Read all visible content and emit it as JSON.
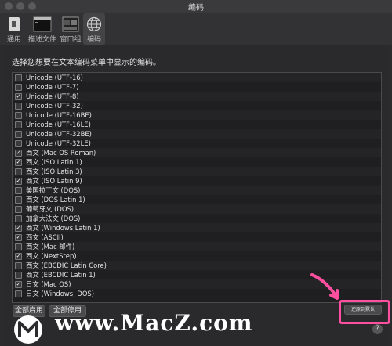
{
  "window": {
    "title": "编码"
  },
  "toolbar": {
    "items": [
      {
        "label": "通用",
        "icon": "switch-icon"
      },
      {
        "label": "描述文件",
        "icon": "profile-icon"
      },
      {
        "label": "窗口组",
        "icon": "window-group-icon"
      },
      {
        "label": "编码",
        "icon": "globe-icon",
        "selected": true
      }
    ]
  },
  "prompt": "选择您想要在文本编码菜单中显示的编码。",
  "encodings": [
    {
      "label": "Unicode (UTF-16)",
      "checked": false
    },
    {
      "label": "Unicode (UTF-7)",
      "checked": false
    },
    {
      "label": "Unicode (UTF-8)",
      "checked": true
    },
    {
      "label": "Unicode (UTF-32)",
      "checked": false
    },
    {
      "label": "Unicode (UTF-16BE)",
      "checked": false
    },
    {
      "label": "Unicode (UTF-16LE)",
      "checked": false
    },
    {
      "label": "Unicode (UTF-32BE)",
      "checked": false
    },
    {
      "label": "Unicode (UTF-32LE)",
      "checked": false
    },
    {
      "label": "西文 (Mac OS Roman)",
      "checked": true
    },
    {
      "label": "西文 (ISO Latin 1)",
      "checked": true
    },
    {
      "label": "西文 (ISO Latin 3)",
      "checked": false
    },
    {
      "label": "西文 (ISO Latin 9)",
      "checked": true
    },
    {
      "label": "美国拉丁文 (DOS)",
      "checked": false
    },
    {
      "label": "西文 (DOS Latin 1)",
      "checked": false
    },
    {
      "label": "葡萄牙文 (DOS)",
      "checked": false
    },
    {
      "label": "加拿大法文 (DOS)",
      "checked": false
    },
    {
      "label": "西文 (Windows Latin 1)",
      "checked": true
    },
    {
      "label": "西文 (ASCII)",
      "checked": true
    },
    {
      "label": "西文 (Mac 邮件)",
      "checked": false
    },
    {
      "label": "西文 (NextStep)",
      "checked": true
    },
    {
      "label": "西文 (EBCDIC Latin Core)",
      "checked": false
    },
    {
      "label": "西文 (EBCDIC Latin 1)",
      "checked": false
    },
    {
      "label": "日文 (Mac OS)",
      "checked": true
    },
    {
      "label": "日文 (Windows, DOS)",
      "checked": false
    }
  ],
  "buttons": {
    "enable_all": "全部启用",
    "disable_all": "全部停用",
    "restore_defaults": "还原到默认"
  },
  "watermark": "www.MacZ.com",
  "colors": {
    "highlight": "#ff4fa0",
    "background": "#2b2b2d"
  }
}
